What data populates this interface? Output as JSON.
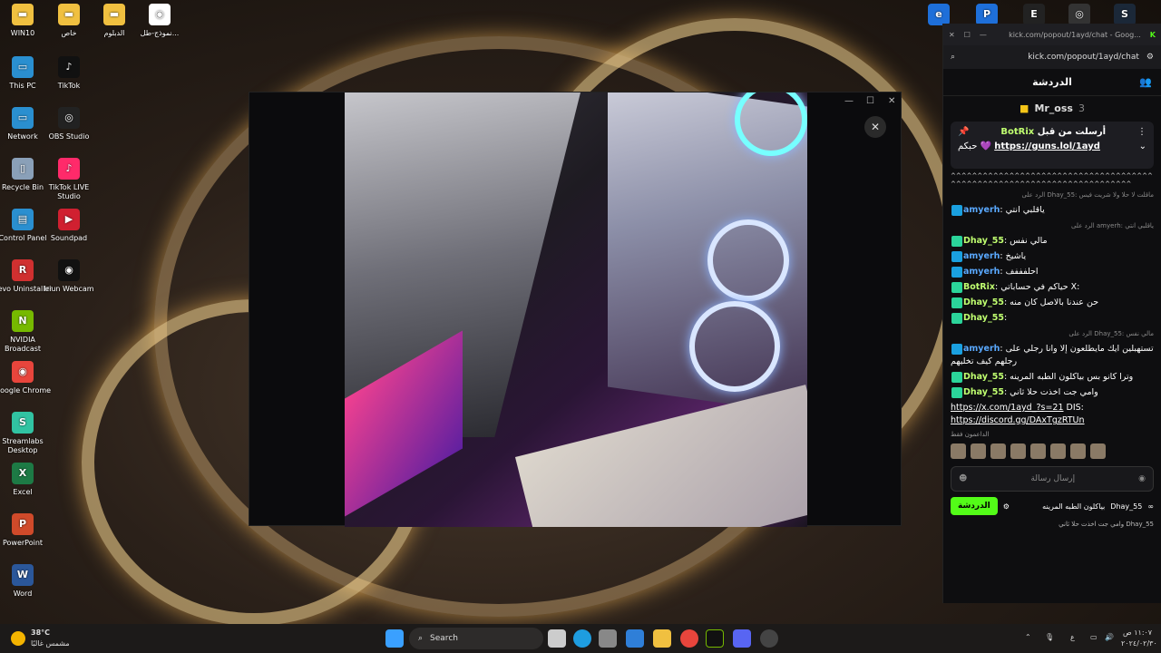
{
  "desktop_icons": [
    {
      "label": "WIN10",
      "color": "#f0c040",
      "glyph": "▬"
    },
    {
      "label": "خاص",
      "color": "#f0c040",
      "glyph": "▬"
    },
    {
      "label": "الدبلوم",
      "color": "#f0c040",
      "glyph": "▬"
    },
    {
      "label": "نموذج-طل...",
      "color": "#ffffff",
      "glyph": "◉"
    },
    {
      "label": "This PC",
      "color": "#2a8fd0",
      "glyph": "▭"
    },
    {
      "label": "TikTok",
      "color": "#111111",
      "glyph": "♪"
    },
    {
      "label": "Network",
      "color": "#2a8fd0",
      "glyph": "▭"
    },
    {
      "label": "OBS Studio",
      "color": "#222222",
      "glyph": "◎"
    },
    {
      "label": "Recycle Bin",
      "color": "#8aa0b8",
      "glyph": "▯"
    },
    {
      "label": "TikTok LIVE Studio",
      "color": "#ff2a6a",
      "glyph": "♪"
    },
    {
      "label": "Control Panel",
      "color": "#2a8fd0",
      "glyph": "▤"
    },
    {
      "label": "Soundpad",
      "color": "#d02030",
      "glyph": "▶"
    },
    {
      "label": "Revo Uninstaller",
      "color": "#d03030",
      "glyph": "R"
    },
    {
      "label": "Iriun Webcam",
      "color": "#111111",
      "glyph": "◉"
    },
    {
      "label": "NVIDIA Broadcast",
      "color": "#76b900",
      "glyph": "N"
    },
    {
      "label": "Google Chrome",
      "color": "#e8453c",
      "glyph": "◉"
    },
    {
      "label": "Streamlabs Desktop",
      "color": "#31c3a2",
      "glyph": "S"
    },
    {
      "label": "Excel",
      "color": "#1d7a45",
      "glyph": "X"
    },
    {
      "label": "PowerPoint",
      "color": "#d04a2a",
      "glyph": "P"
    },
    {
      "label": "Word",
      "color": "#2b579a",
      "glyph": "W"
    }
  ],
  "viewer": {
    "close_glyph": "✕",
    "min_glyph": "—",
    "max_glyph": "☐",
    "win_close_glyph": "✕"
  },
  "chat_window": {
    "tab_title": "kick.com/popout/1ayd/chat - Goog...",
    "url": "kick.com/popout/1ayd/chat",
    "header": "الدردشة",
    "top_viewer": {
      "name": "Mr_oss",
      "count": "3"
    },
    "pinned": {
      "label": "أرسلت من قبل",
      "user": "BotRix",
      "link": "https://guns.lol/1ayd",
      "suffix": "حبكم"
    },
    "spam": "^^^^^^^^^^^^^^^^^^^^^^^^^^^^^^^^^^^^^^^^^^^^^^^^^^^^^^^^^^^^^^^^^^^^^^^^",
    "messages": [
      {
        "reply": "الرد على Dhay_55: ماقلت لا حلا ولا شريت فيس",
        "user": "amyerh",
        "text": "ياقلبي انتي"
      },
      {
        "reply": "الرد على amyerh: ياقلبي انتي",
        "user": "Dhay_55",
        "text": "مالي نفس",
        "green": true
      },
      {
        "reply": "",
        "user": "amyerh",
        "text": "ياشيخ"
      },
      {
        "reply": "",
        "user": "amyerh",
        "text": "احلفففف"
      },
      {
        "reply": "",
        "user": "BotRix",
        "text": "حياكم في حساباتي X:",
        "green": true
      },
      {
        "reply": "",
        "user": "Dhay_55",
        "text": "حن عندنا بالاصل كان منه",
        "green": true
      },
      {
        "reply": "",
        "user": "Dhay_55",
        "text": "",
        "green": true
      },
      {
        "reply": "الرد على Dhay_55: مالي نفس",
        "user": "amyerh",
        "text": "تستهبلين ايك مايطلعون إلا وانا رجلي على رجلهم كيف تخليهم"
      },
      {
        "reply": "",
        "user": "Dhay_55",
        "text": "وترا كانو بس بياكلون الطبه المرينه",
        "green": true
      },
      {
        "reply": "",
        "user": "Dhay_55",
        "text": "وامي جت اخذت حلا ثاني",
        "green": true
      }
    ],
    "botrix_links": [
      "https://x.com/1ayd_?s=21",
      "DIS:",
      "https://discord.gg/DAxTgzRTUn"
    ],
    "supporters_label": "الداعمون فقط",
    "input_placeholder": "إرسال رسالة",
    "send_label": "الدردشة",
    "footer_user": "Dhay_55",
    "footer_text": "بياكلون الطبه المرينه",
    "footer_user2": "Dhay_55",
    "footer_text2": "وامي جت اخذت حلا ثاني"
  },
  "taskbar": {
    "weather_temp": "38°C",
    "weather_desc": "مشمس غالبًا",
    "search_label": "Search",
    "time": "١١:٠٧ ص",
    "date": "٢٠٢٤/٠٢/٣٠",
    "lang": "ع"
  }
}
